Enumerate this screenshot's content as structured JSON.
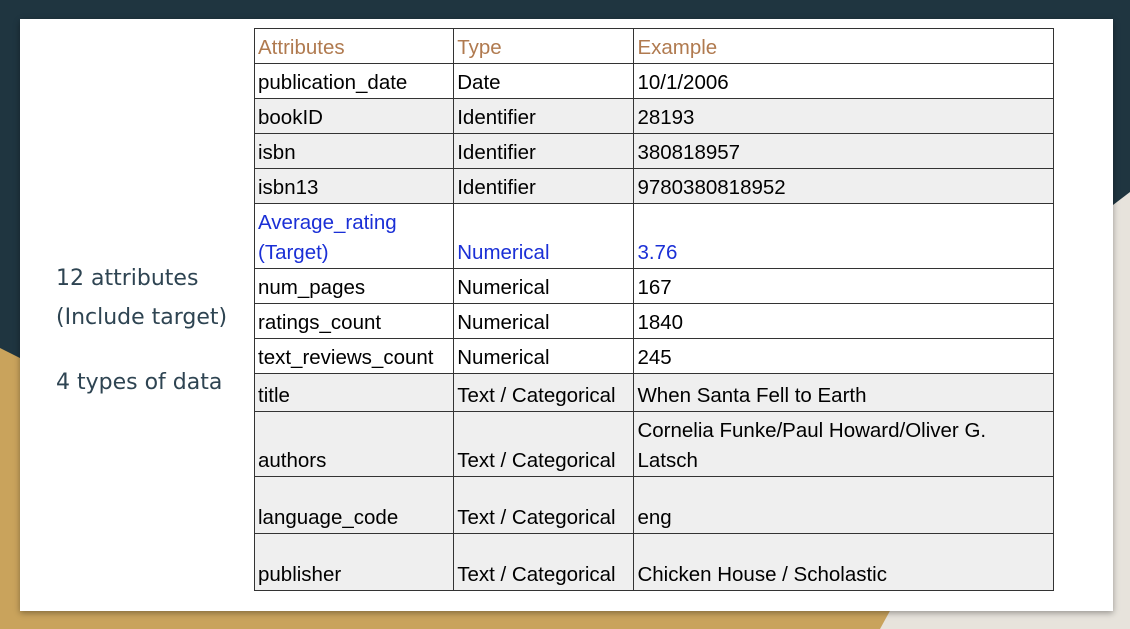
{
  "side": {
    "line1": "12 attributes",
    "line2": "(Include target)",
    "line3": "4 types of data"
  },
  "colors": {
    "header_text": "#b07a4f",
    "target_text": "#1a2fd6",
    "frame_dark": "#1f3540",
    "frame_gold": "#c9a35c"
  },
  "table": {
    "headers": [
      "Attributes",
      "Type",
      "Example"
    ],
    "rows": [
      {
        "attribute": "publication_date",
        "type": "Date",
        "example": "10/1/2006"
      },
      {
        "attribute": "bookID",
        "type": "Identifier",
        "example": "28193"
      },
      {
        "attribute": "isbn",
        "type": "Identifier",
        "example": "380818957"
      },
      {
        "attribute": "isbn13",
        "type": "Identifier",
        "example": "9780380818952"
      },
      {
        "attribute": "Average_rating (Target)",
        "type": "Numerical",
        "example": "3.76"
      },
      {
        "attribute": "num_pages",
        "type": "Numerical",
        "example": "167"
      },
      {
        "attribute": "ratings_count",
        "type": "Numerical",
        "example": "1840"
      },
      {
        "attribute": "text_reviews_count",
        "type": "Numerical",
        "example": "245"
      },
      {
        "attribute": "title",
        "type": "Text / Categorical",
        "example": "When Santa Fell to Earth"
      },
      {
        "attribute": "authors",
        "type": "Text / Categorical",
        "example": "Cornelia Funke/Paul Howard/Oliver G. Latsch"
      },
      {
        "attribute": "language_code",
        "type": "Text / Categorical",
        "example": "eng"
      },
      {
        "attribute": "publisher",
        "type": "Text / Categorical",
        "example": "Chicken House / Scholastic"
      }
    ]
  }
}
